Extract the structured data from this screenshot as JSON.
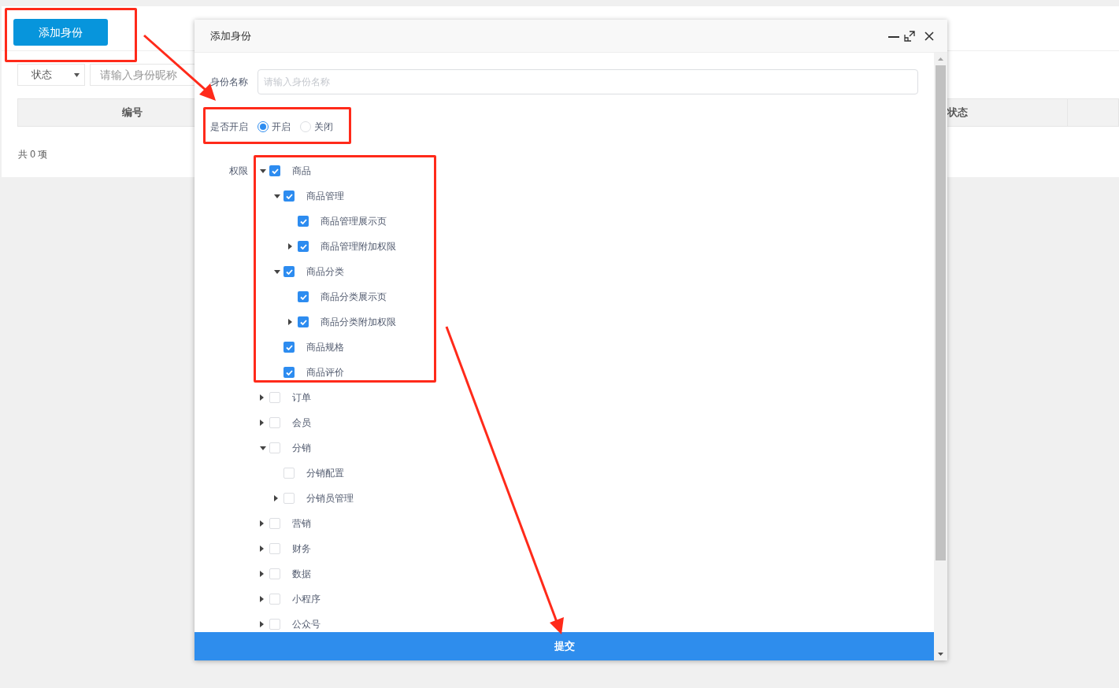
{
  "page": {
    "add_button": "添加身份",
    "status_select": "状态",
    "nickname_search": {
      "placeholder": "请输入身份昵称"
    },
    "table": {
      "columns": [
        "编号",
        "状态"
      ]
    },
    "total": "共 0 项"
  },
  "dialog": {
    "title": "添加身份",
    "name_field": {
      "label": "身份名称",
      "placeholder": "请输入身份名称"
    },
    "enabled": {
      "label": "是否开启",
      "options": [
        {
          "label": "开启",
          "selected": true
        },
        {
          "label": "关闭",
          "selected": false
        }
      ]
    },
    "permissions": {
      "label": "权限",
      "tree": [
        {
          "label": "商品",
          "checked": true,
          "expanded": true,
          "children": [
            {
              "label": "商品管理",
              "checked": true,
              "expanded": true,
              "children": [
                {
                  "label": "商品管理展示页",
                  "checked": true
                },
                {
                  "label": "商品管理附加权限",
                  "checked": true,
                  "expanded": false
                }
              ]
            },
            {
              "label": "商品分类",
              "checked": true,
              "expanded": true,
              "children": [
                {
                  "label": "商品分类展示页",
                  "checked": true
                },
                {
                  "label": "商品分类附加权限",
                  "checked": true,
                  "expanded": false
                }
              ]
            },
            {
              "label": "商品规格",
              "checked": true
            },
            {
              "label": "商品评价",
              "checked": true
            }
          ]
        },
        {
          "label": "订单",
          "checked": false,
          "expanded": false
        },
        {
          "label": "会员",
          "checked": false,
          "expanded": false
        },
        {
          "label": "分销",
          "checked": false,
          "expanded": true,
          "children": [
            {
              "label": "分销配置",
              "checked": false
            },
            {
              "label": "分销员管理",
              "checked": false,
              "expanded": false
            }
          ]
        },
        {
          "label": "营销",
          "checked": false,
          "expanded": false
        },
        {
          "label": "财务",
          "checked": false,
          "expanded": false
        },
        {
          "label": "数据",
          "checked": false,
          "expanded": false
        },
        {
          "label": "小程序",
          "checked": false,
          "expanded": false
        },
        {
          "label": "公众号",
          "checked": false,
          "expanded": false
        }
      ]
    },
    "submit": "提交"
  }
}
